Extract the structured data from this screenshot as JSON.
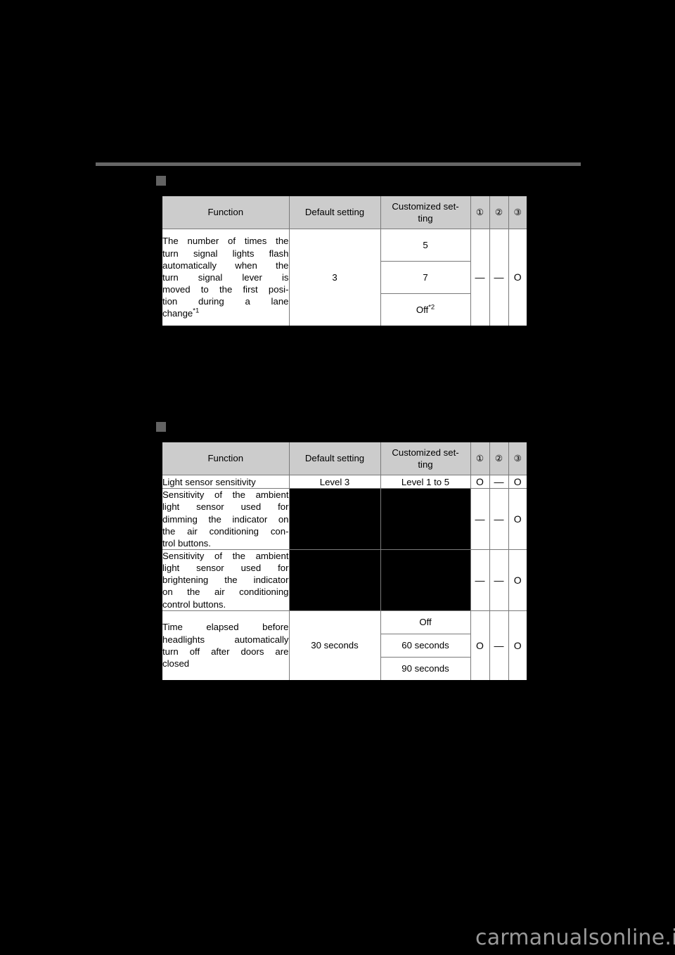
{
  "page": {
    "background_color": "#000000",
    "rule_color": "#666666",
    "bullet_color": "#636363",
    "header_fill": "#cccccc",
    "watermark": "carmanualsonline.info",
    "watermark_color": "#9a9a9a"
  },
  "columns": {
    "function": "Function",
    "default_setting": "Default setting",
    "customized_setting": "Customized set-ting",
    "customized_setting_line1": "Customized set-",
    "customized_setting_line2": "ting",
    "mark1": "①",
    "mark2": "②",
    "mark3": "③"
  },
  "tables": [
    {
      "id": "turn-signal-table",
      "rows": [
        {
          "function_lines": [
            "The number of times the",
            "turn signal lights flash",
            "automatically when the",
            "turn signal lever is",
            "moved to the first posi-",
            "tion during a lane",
            "change"
          ],
          "function_superscript": "*1",
          "default_setting": "3",
          "customized_options": [
            {
              "label": "5",
              "superscript": ""
            },
            {
              "label": "7",
              "superscript": ""
            },
            {
              "label": "Off",
              "superscript": "*2"
            }
          ],
          "mark1": "—",
          "mark2": "—",
          "mark3": "O"
        }
      ]
    },
    {
      "id": "light-sensor-table",
      "rows": [
        {
          "function_lines": [
            "Light sensor sensitivity"
          ],
          "function_superscript": "",
          "default_setting": "Level 3",
          "customized_options": [
            {
              "label": "Level 1 to 5",
              "superscript": ""
            }
          ],
          "mark1": "O",
          "mark2": "—",
          "mark3": "O"
        },
        {
          "function_lines": [
            "Sensitivity of the ambient",
            "light sensor used for",
            "dimming the indicator on",
            "the air conditioning con-",
            "trol buttons."
          ],
          "function_superscript": "",
          "default_setting": "",
          "customized_options": [],
          "redacted": true,
          "mark1": "—",
          "mark2": "—",
          "mark3": "O"
        },
        {
          "function_lines": [
            "Sensitivity of the ambient",
            "light sensor used for",
            "brightening the indicator",
            "on the air conditioning",
            "control buttons."
          ],
          "function_superscript": "",
          "default_setting": "",
          "customized_options": [],
          "redacted": true,
          "mark1": "—",
          "mark2": "—",
          "mark3": "O"
        },
        {
          "function_lines": [
            "Time elapsed before",
            "headlights automatically",
            "turn off after doors are",
            "closed"
          ],
          "function_superscript": "",
          "default_setting": "30 seconds",
          "customized_options": [
            {
              "label": "Off",
              "superscript": ""
            },
            {
              "label": "60 seconds",
              "superscript": ""
            },
            {
              "label": "90 seconds",
              "superscript": ""
            }
          ],
          "mark1": "O",
          "mark2": "—",
          "mark3": "O"
        }
      ]
    }
  ]
}
